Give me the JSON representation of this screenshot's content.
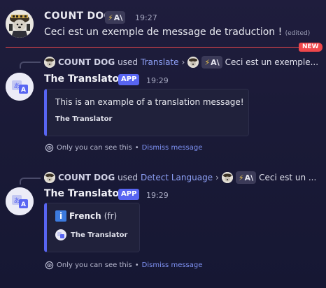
{
  "message1": {
    "username": "COUNT DOG",
    "badge_text": "A\\",
    "time": "19:27",
    "text": "Ceci est un exemple de message de traduction !",
    "edited": "(edited)"
  },
  "new_label": "NEW",
  "reply1": {
    "user": "COUNT DOG",
    "used": "used",
    "command": "Translate",
    "chevron": "›",
    "badge_text": "A\\",
    "preview": "Ceci est un exemple..."
  },
  "bot1": {
    "name": "The Translator",
    "app_tag": "APP",
    "time": "19:29",
    "embed_text": "This is an example of a translation message!",
    "embed_footer": "The Translator",
    "ephemeral_text": "Only you can see this",
    "dot": "•",
    "dismiss": "Dismiss message"
  },
  "reply2": {
    "user": "COUNT DOG",
    "used": "used",
    "command": "Detect Language",
    "chevron": "›",
    "badge_text": "A\\",
    "preview": "Ceci est un ..."
  },
  "bot2": {
    "name": "The Translator",
    "app_tag": "APP",
    "time": "19:29",
    "info_glyph": "i",
    "language": "French",
    "language_code": "(fr)",
    "embed_footer": "The Translator",
    "ephemeral_text": "Only you can see this",
    "dot": "•",
    "dismiss": "Dismiss message"
  },
  "colors": {
    "accent": "#5865f2",
    "new_red": "#f0474b",
    "link": "#8ea1f7"
  }
}
